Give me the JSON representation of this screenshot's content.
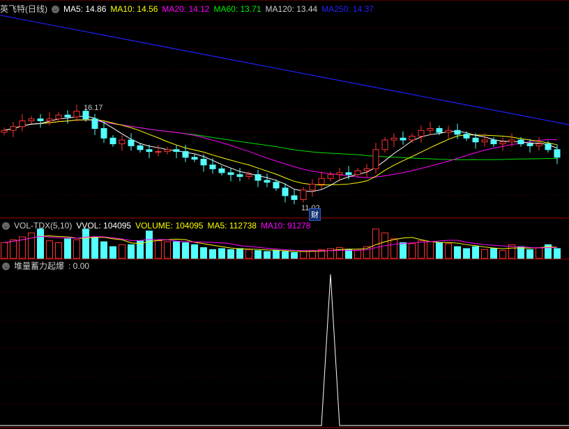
{
  "header": {
    "title": "英飞特(日线)",
    "ma5": "MA5: 14.86",
    "ma10": "MA10: 14.56",
    "ma20": "MA20: 14.12",
    "ma60": "MA60: 13.71",
    "ma120": "MA120: 13.44",
    "ma250": "MA250: 14.37"
  },
  "volume_header": {
    "name": "VOL-TDX(5,10)",
    "vvol": "VVOL: 104095",
    "volume": "VOLUME: 104095",
    "ma5": "MA5: 112738",
    "ma10": "MA10: 91278"
  },
  "indicator_header": {
    "name": "堆量蓄力起爆",
    "value": ": 0.00"
  },
  "annotations": {
    "high": "16.17",
    "low": "11.02",
    "badge": "财"
  },
  "colors": {
    "up": "#ff3232",
    "down": "#54ffff",
    "ma5": "#ffffff",
    "ma10": "#ffff00",
    "ma20": "#ff00ff",
    "ma60": "#00e000",
    "ma250": "#2020ff"
  },
  "chart_data": {
    "type": "candlestick",
    "closes": [
      15.0,
      15.2,
      15.5,
      15.6,
      15.5,
      15.6,
      15.8,
      15.7,
      16.0,
      15.6,
      15.1,
      14.6,
      14.3,
      14.5,
      14.2,
      14.0,
      13.9,
      13.9,
      14.0,
      13.9,
      13.6,
      13.5,
      13.2,
      13.0,
      12.8,
      12.7,
      12.6,
      12.7,
      12.4,
      12.3,
      12.0,
      11.6,
      11.4,
      11.9,
      12.2,
      12.5,
      12.7,
      12.8,
      12.7,
      12.9,
      13.0,
      14.0,
      14.5,
      14.6,
      14.5,
      14.7,
      15.0,
      15.1,
      14.9,
      15.0,
      14.8,
      14.6,
      14.4,
      14.5,
      14.3,
      14.4,
      14.5,
      14.3,
      14.2,
      14.3,
      14.0,
      13.6
    ],
    "volumes": [
      80000,
      95000,
      110000,
      130000,
      150000,
      90000,
      80000,
      100000,
      95000,
      150000,
      110000,
      85000,
      60000,
      70000,
      70000,
      90000,
      140000,
      90000,
      85000,
      85000,
      80000,
      70000,
      55000,
      45000,
      50000,
      45000,
      50000,
      45000,
      40000,
      35000,
      40000,
      35000,
      30000,
      35000,
      40000,
      45000,
      50000,
      55000,
      45000,
      40000,
      60000,
      150000,
      130000,
      100000,
      80000,
      75000,
      90000,
      85000,
      80000,
      75000,
      60000,
      50000,
      60000,
      45000,
      50000,
      40000,
      70000,
      60000,
      45000,
      55000,
      70000,
      50000
    ],
    "indicator": [
      0,
      0,
      0,
      0,
      0,
      0,
      0,
      0,
      0,
      0,
      0,
      0,
      0,
      0,
      0,
      0,
      0,
      0,
      0,
      0,
      0,
      0,
      0,
      0,
      0,
      0,
      0,
      0,
      0,
      0,
      0,
      0,
      0,
      0,
      0,
      0,
      100,
      0,
      0,
      0,
      0,
      0,
      0,
      0,
      0,
      0,
      0,
      0,
      0,
      0,
      0,
      0,
      0,
      0,
      0,
      0,
      0,
      0,
      0,
      0,
      0,
      0
    ],
    "ma250_range": [
      21.0,
      15.3
    ],
    "price_range": [
      10.44,
      21.5
    ],
    "volume_max": 160000
  }
}
